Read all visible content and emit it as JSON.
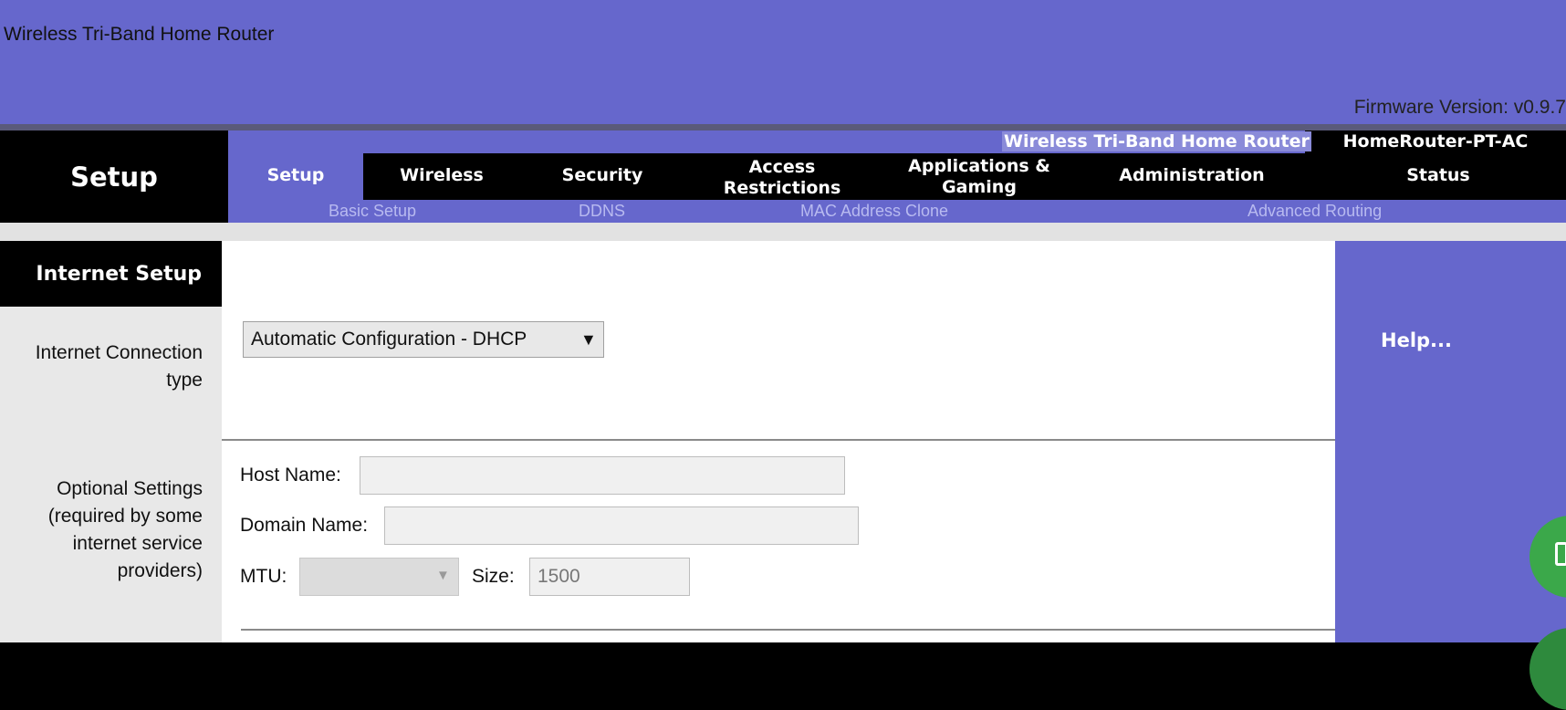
{
  "banner": {
    "title": "Wireless Tri-Band Home Router",
    "firmware": "Firmware Version: v0.9.7"
  },
  "nav": {
    "section_title": "Setup",
    "router_name": "Wireless Tri-Band Home Router",
    "model_name": "HomeRouter-PT-AC",
    "tabs": [
      {
        "label": "Setup",
        "active": true
      },
      {
        "label": "Wireless"
      },
      {
        "label": "Security"
      },
      {
        "label": "Access Restrictions"
      },
      {
        "label": "Applications & Gaming"
      },
      {
        "label": "Administration"
      },
      {
        "label": "Status"
      }
    ],
    "subtabs": [
      "Basic Setup",
      "DDNS",
      "MAC Address Clone",
      "Advanced Routing"
    ]
  },
  "sidebar": {
    "heading": "Internet Setup",
    "connection_label": "Internet Connection type",
    "optional_label": "Optional Settings (required by some internet service providers)"
  },
  "form": {
    "connection_type": "Automatic Configuration - DHCP",
    "host_name_label": "Host Name:",
    "host_name_value": "",
    "domain_name_label": "Domain Name:",
    "domain_name_value": "",
    "mtu_label": "MTU:",
    "mtu_value": "",
    "size_label": "Size:",
    "size_value": "1500"
  },
  "help": {
    "link": "Help..."
  },
  "colors": {
    "accent_purple": "#6667CC",
    "nav_black": "#000000",
    "fab_green": "#3BA84A"
  }
}
